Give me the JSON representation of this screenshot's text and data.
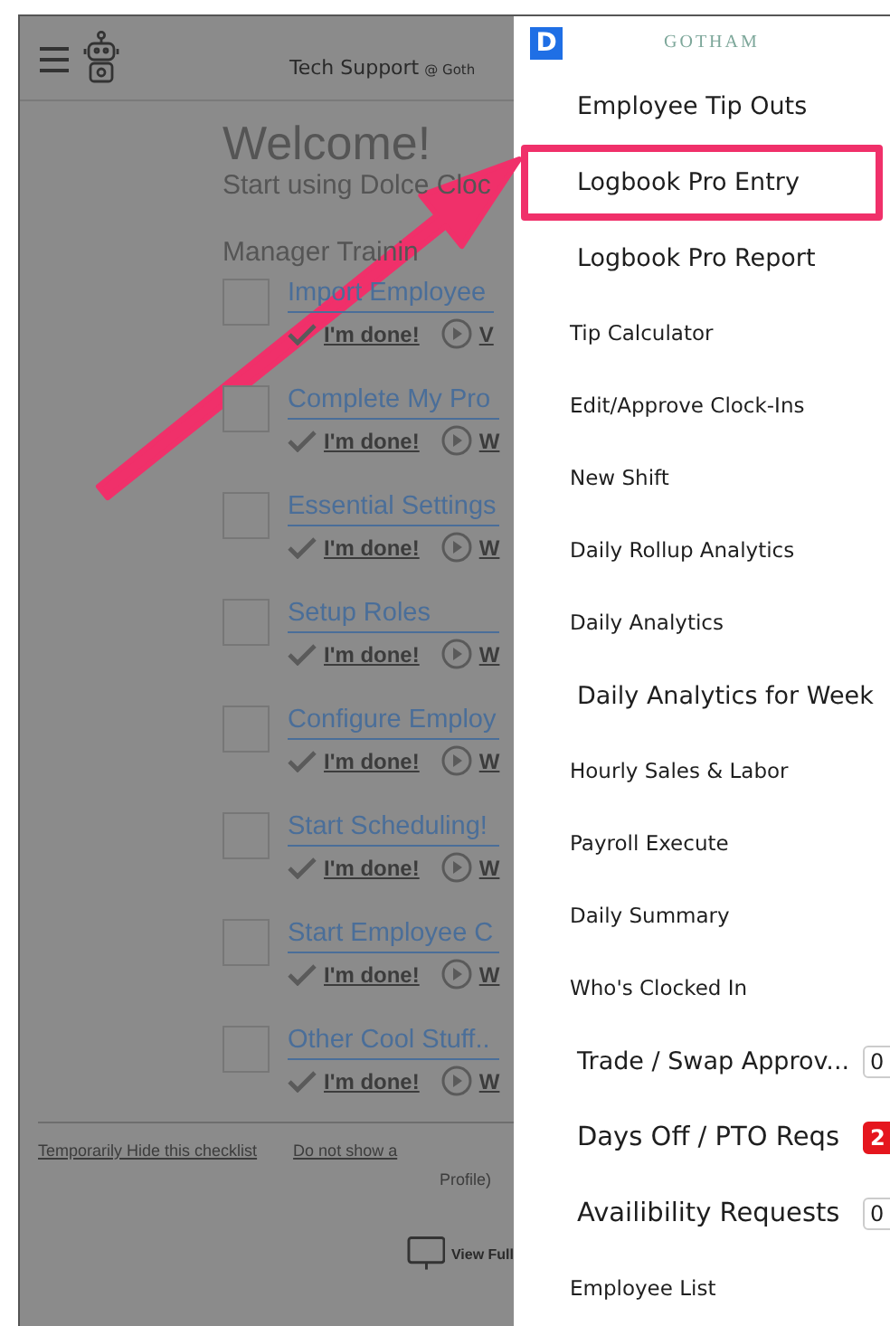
{
  "header": {
    "user": "Tech Support",
    "location": "@ Goth"
  },
  "welcome": {
    "title": "Welcome!",
    "subtitle": "Start using Dolce Cloc",
    "section": "Manager Trainin"
  },
  "checklist": [
    {
      "title": "Import Employee",
      "checked": false,
      "done": "I'm done!",
      "watch": "V"
    },
    {
      "title": "Complete My Pro",
      "checked": false,
      "done": "I'm done!",
      "watch": "W"
    },
    {
      "title": "Essential Settings",
      "checked": false,
      "done": "I'm done!",
      "watch": "W"
    },
    {
      "title": "Setup Roles",
      "checked": false,
      "done": "I'm done!",
      "watch": "W"
    },
    {
      "title": "Configure Employ",
      "checked": false,
      "done": "I'm done!",
      "watch": "W"
    },
    {
      "title": "Start Scheduling!",
      "checked": false,
      "done": "I'm done!",
      "watch": "W"
    },
    {
      "title": "Start Employee C",
      "checked": false,
      "done": "I'm done!",
      "watch": "W"
    },
    {
      "title": "Other Cool Stuff..",
      "checked": false,
      "done": "I'm done!",
      "watch": "W"
    }
  ],
  "footer": {
    "hide_link": "Temporarily Hide this checklist",
    "never_link": "Do not show a",
    "note": "Profile)",
    "view_full": "View Full"
  },
  "drawer": {
    "logo_letter": "D",
    "brand": "GOTHAM",
    "items": [
      {
        "label": "Employee Tip Outs",
        "kind": "main",
        "highlighted": false
      },
      {
        "label": "Logbook Pro Entry",
        "kind": "main",
        "highlighted": true
      },
      {
        "label": "Logbook Pro Report",
        "kind": "main",
        "highlighted": false
      },
      {
        "label": "Tip Calculator",
        "kind": "sub",
        "highlighted": false
      },
      {
        "label": "Edit/Approve Clock-Ins",
        "kind": "sub",
        "highlighted": false
      },
      {
        "label": "New Shift",
        "kind": "sub",
        "highlighted": false
      },
      {
        "label": "Daily Rollup Analytics",
        "kind": "sub",
        "highlighted": false
      },
      {
        "label": "Daily Analytics",
        "kind": "sub",
        "highlighted": false
      },
      {
        "label": "Daily Analytics for Week",
        "kind": "main",
        "highlighted": false
      },
      {
        "label": "Hourly Sales & Labor",
        "kind": "sub",
        "highlighted": false
      },
      {
        "label": "Payroll Execute",
        "kind": "sub",
        "highlighted": false
      },
      {
        "label": "Daily Summary",
        "kind": "sub",
        "highlighted": false
      },
      {
        "label": "Who's Clocked In",
        "kind": "sub",
        "highlighted": false
      },
      {
        "label": "Trade / Swap Approv...",
        "kind": "main",
        "highlighted": false,
        "badge": {
          "text": "0",
          "alert": false
        }
      },
      {
        "label": "Days Off / PTO Reqs",
        "kind": "large",
        "highlighted": false,
        "badge": {
          "text": "2",
          "alert": true
        }
      },
      {
        "label": "Availibility Requests",
        "kind": "large",
        "highlighted": false,
        "badge": {
          "text": "0",
          "alert": false
        }
      },
      {
        "label": "Employee List",
        "kind": "sub",
        "highlighted": false
      }
    ]
  }
}
